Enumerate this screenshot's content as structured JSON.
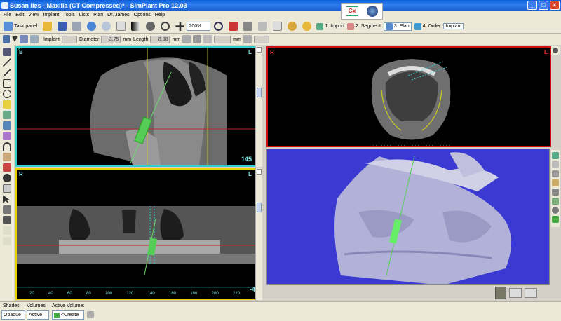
{
  "window": {
    "title": "Susan Iles - Maxilla (CT Compressed)* - SimPlant Pro  12.03"
  },
  "menu": [
    "File",
    "Edit",
    "View",
    "Implant",
    "Tools",
    "Lists",
    "Plan",
    "Dr. James",
    "Options",
    "Help"
  ],
  "logos": {
    "gx_label": "Gx"
  },
  "toolbar": {
    "task_panel": "Task panel",
    "zoom": "200%",
    "steps": [
      {
        "label": "1. Import"
      },
      {
        "label": "2. Segment"
      },
      {
        "label": "3. Plan"
      },
      {
        "label": "4. Order"
      }
    ],
    "implant_tab": "Implant"
  },
  "implant_bar": {
    "implant_label": "Implant",
    "diameter_label": "Diameter",
    "diameter_value": "3.75",
    "mm1": "mm",
    "length_label": "Length",
    "length_value": "8.00",
    "mm2": "mm",
    "mm3": "mm"
  },
  "views": {
    "top_left": {
      "corner_left": "B",
      "corner_right": "L",
      "slice": "145"
    },
    "top_right": {
      "corner_left": "R",
      "corner_right": "L"
    },
    "bottom_left": {
      "corner_left": "R",
      "corner_right": "L",
      "slice": "-4",
      "ruler": [
        "20",
        "40",
        "60",
        "80",
        "100",
        "120",
        "140",
        "160",
        "180",
        "200",
        "220"
      ]
    }
  },
  "status": {
    "shades_label": "Shades:",
    "volumes_label": "Volumes",
    "active_volume_label": "Active Volume:",
    "shades_value": "Opaque",
    "volumes_value": "Active",
    "active_volume_value": "<Create"
  },
  "colors": {
    "accent_cyan": "#7fe0e0",
    "axial_border": "#cc1111",
    "panoramic_border": "#e6d200",
    "render_bg": "#3a3ad2"
  }
}
